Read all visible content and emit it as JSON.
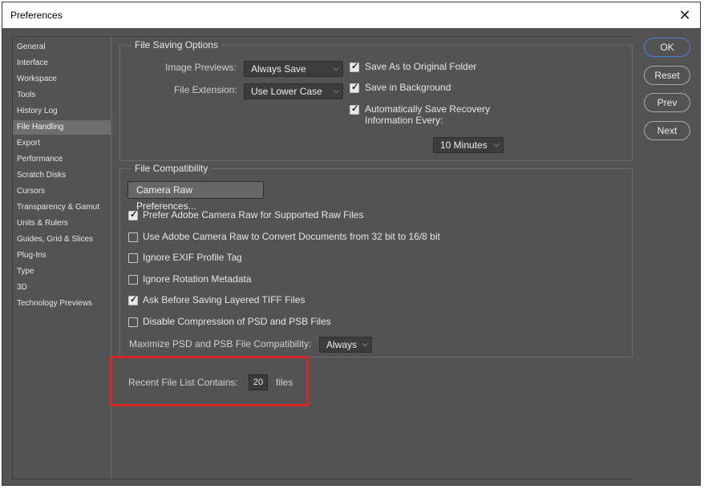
{
  "window": {
    "title": "Preferences",
    "close_glyph": "✕"
  },
  "sidebar": {
    "items": [
      "General",
      "Interface",
      "Workspace",
      "Tools",
      "History Log",
      "File Handling",
      "Export",
      "Performance",
      "Scratch Disks",
      "Cursors",
      "Transparency & Gamut",
      "Units & Rulers",
      "Guides, Grid & Slices",
      "Plug-Ins",
      "Type",
      "3D",
      "Technology Previews"
    ],
    "active_item": "File Handling"
  },
  "file_saving": {
    "title": "File Saving Options",
    "image_previews_label": "Image Previews:",
    "image_previews_value": "Always Save",
    "file_extension_label": "File Extension:",
    "file_extension_value": "Use Lower Case",
    "save_original_folder": "Save As to Original Folder",
    "save_background": "Save in Background",
    "auto_recovery_line1": "Automatically Save Recovery",
    "auto_recovery_line2": "Information Every:",
    "auto_recovery_interval": "10 Minutes"
  },
  "file_compat": {
    "title": "File Compatibility",
    "camera_raw_button": "Camera Raw Preferences...",
    "options": [
      {
        "label": "Prefer Adobe Camera Raw for Supported Raw Files",
        "checked": true
      },
      {
        "label": "Use Adobe Camera Raw to Convert Documents from 32 bit to 16/8 bit",
        "checked": false
      },
      {
        "label": "Ignore EXIF Profile Tag",
        "checked": false
      },
      {
        "label": "Ignore Rotation Metadata",
        "checked": false
      },
      {
        "label": "Ask Before Saving Layered TIFF Files",
        "checked": true
      },
      {
        "label": "Disable Compression of PSD and PSB Files",
        "checked": false
      }
    ],
    "maximize_label": "Maximize PSD and PSB File Compatibility:",
    "maximize_value": "Always"
  },
  "recent": {
    "label": "Recent File List Contains:",
    "value": "20",
    "unit": "files"
  },
  "buttons": {
    "ok": "OK",
    "reset": "Reset",
    "prev": "Prev",
    "next": "Next"
  },
  "colors": {
    "panel": "#535353",
    "highlight": "#d92525",
    "focus": "#4b82d6"
  }
}
